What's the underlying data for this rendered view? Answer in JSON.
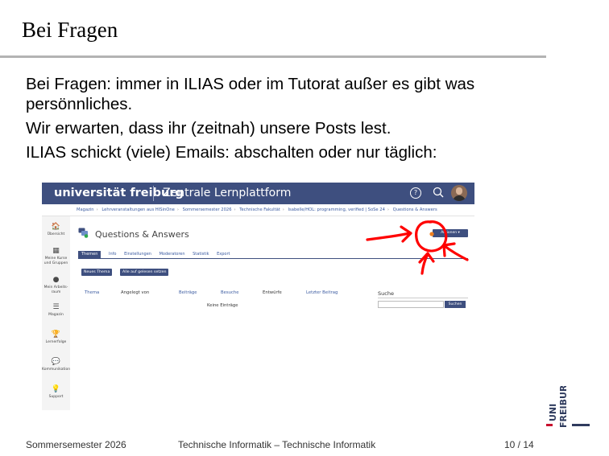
{
  "slide": {
    "title": "Bei Fragen",
    "bullets": [
      "Bei Fragen: immer in ILIAS oder im Tutorat außer es gibt was persönnliches.",
      "Wir erwarten, dass ihr (zeitnah) unsere Posts lest.",
      "ILIAS schickt (viele) Emails: abschalten oder nur täglich:"
    ]
  },
  "screenshot": {
    "logo": "universität freiburg",
    "platform": "Zentrale Lernplattform",
    "help_icon": "?",
    "breadcrumbs": [
      "Magazin",
      "Lehrveranstaltungen aus HISinOne",
      "Sommersemester 2026",
      "Technische Fakultät",
      "Isabelle/HOL: programming, verified | SoSe 24",
      "Questions & Answers"
    ],
    "sidebar": [
      {
        "icon": "home-icon",
        "glyph": "🏠",
        "label": "Übersicht"
      },
      {
        "icon": "courses-icon",
        "glyph": "▦",
        "label": "Meine Kurse und Gruppen"
      },
      {
        "icon": "person-icon",
        "glyph": "●",
        "label": "Mein Arbeits-raum"
      },
      {
        "icon": "list-icon",
        "glyph": "☰",
        "label": "Magazin"
      },
      {
        "icon": "trophy-icon",
        "glyph": "🏆",
        "label": "Lernerfolge"
      },
      {
        "icon": "chat-icon",
        "glyph": "💬",
        "label": "Kommunikation"
      },
      {
        "icon": "lightbulb-icon",
        "glyph": "💡",
        "label": "Support"
      }
    ],
    "page_title": "Questions & Answers",
    "actions_label": "Aktionen ▾",
    "tabs": [
      "Themen",
      "Info",
      "Einstellungen",
      "Moderatoren",
      "Statistik",
      "Export"
    ],
    "buttons": [
      "Neues Thema",
      "Alle auf gelesen setzen"
    ],
    "table_headers": [
      "Thema",
      "Angelegt von",
      "Beiträge",
      "Besuche",
      "Entwürfe",
      "Letzter Beitrag"
    ],
    "empty_text": "Keine Einträge",
    "search_label": "Suche",
    "search_button": "Suchen"
  },
  "footer": {
    "left": "Sommersemester 2026",
    "center": "Technische Informatik – Technische Informatik",
    "page": "10 / 14"
  },
  "colors": {
    "ilias_blue": "#3e4f7f",
    "annotation_red": "#ff0000",
    "notification_orange": "#f08020",
    "uni_logo": "#2f3b5e",
    "uni_logo_accent": "#c8102e"
  }
}
